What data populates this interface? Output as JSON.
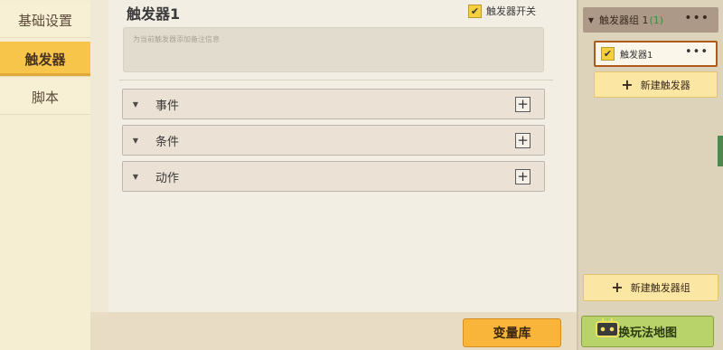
{
  "nav": {
    "items": [
      {
        "label": "基础设置",
        "active": false
      },
      {
        "label": "触发器",
        "active": true
      },
      {
        "label": "脚本",
        "active": false
      }
    ]
  },
  "editor": {
    "title": "触发器1",
    "switch_label": "触发器开关",
    "switch_checked": true,
    "note_placeholder": "为当前触发器添加备注信息",
    "sections": [
      {
        "label": "事件"
      },
      {
        "label": "条件"
      },
      {
        "label": "动作"
      }
    ]
  },
  "right_panel": {
    "group_name": "触发器组 1",
    "group_count": "(1)",
    "trigger_item": "触发器1",
    "new_trigger": "新建触发器",
    "new_group": "新建触发器组"
  },
  "bottom": {
    "variables": "变量库",
    "partial_label": "换玩法地图"
  },
  "icons": {
    "check": "✔",
    "plus": "+",
    "more": "•••",
    "collapse": "▼",
    "watermark": "gamepad-icon"
  },
  "colors": {
    "active_tab": "#f6c54a",
    "variable_button": "#f8b53a",
    "selected_border": "#b05a1a",
    "green_button": "#b8d36a"
  }
}
